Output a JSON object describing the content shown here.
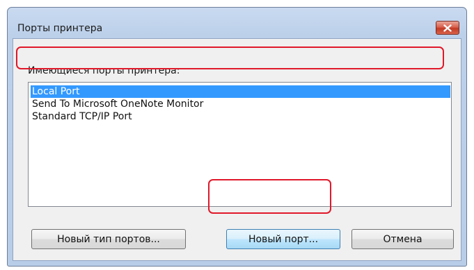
{
  "window": {
    "title": "Порты принтера",
    "close_icon": "close-icon"
  },
  "ports_label": "Имеющиеся порты принтера:",
  "ports": [
    {
      "label": "Local Port",
      "selected": true
    },
    {
      "label": "Send To Microsoft OneNote Monitor",
      "selected": false
    },
    {
      "label": "Standard TCP/IP Port",
      "selected": false
    }
  ],
  "buttons": {
    "new_port_type": "Новый тип портов...",
    "new_port": "Новый порт...",
    "cancel": "Отмена"
  },
  "colors": {
    "selection": "#3399ff",
    "highlight": "#e0182a"
  }
}
